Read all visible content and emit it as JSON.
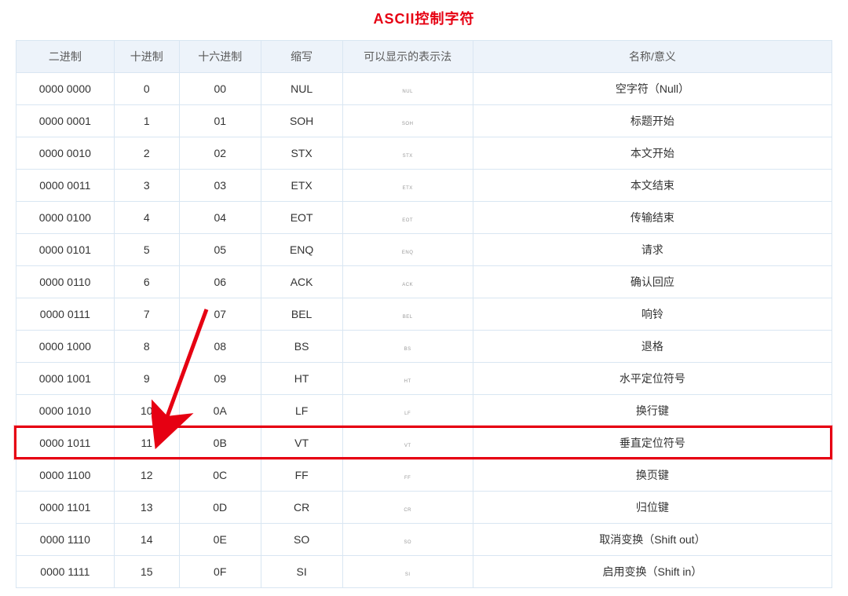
{
  "title": "ASCII控制字符",
  "columns": [
    "二进制",
    "十进制",
    "十六进制",
    "缩写",
    "可以显示的表示法",
    "名称/意义"
  ],
  "highlight_index": 11,
  "rows": [
    {
      "binary": "0000 0000",
      "decimal": "0",
      "hex": "00",
      "abbr": "NUL",
      "disp": "NUL",
      "meaning": "空字符（Null）"
    },
    {
      "binary": "0000 0001",
      "decimal": "1",
      "hex": "01",
      "abbr": "SOH",
      "disp": "SOH",
      "meaning": "标题开始"
    },
    {
      "binary": "0000 0010",
      "decimal": "2",
      "hex": "02",
      "abbr": "STX",
      "disp": "STX",
      "meaning": "本文开始"
    },
    {
      "binary": "0000 0011",
      "decimal": "3",
      "hex": "03",
      "abbr": "ETX",
      "disp": "ETX",
      "meaning": "本文结束"
    },
    {
      "binary": "0000 0100",
      "decimal": "4",
      "hex": "04",
      "abbr": "EOT",
      "disp": "EOT",
      "meaning": "传输结束"
    },
    {
      "binary": "0000 0101",
      "decimal": "5",
      "hex": "05",
      "abbr": "ENQ",
      "disp": "ENQ",
      "meaning": "请求"
    },
    {
      "binary": "0000 0110",
      "decimal": "6",
      "hex": "06",
      "abbr": "ACK",
      "disp": "ACK",
      "meaning": "确认回应"
    },
    {
      "binary": "0000 0111",
      "decimal": "7",
      "hex": "07",
      "abbr": "BEL",
      "disp": "BEL",
      "meaning": "响铃"
    },
    {
      "binary": "0000 1000",
      "decimal": "8",
      "hex": "08",
      "abbr": "BS",
      "disp": "BS",
      "meaning": "退格"
    },
    {
      "binary": "0000 1001",
      "decimal": "9",
      "hex": "09",
      "abbr": "HT",
      "disp": "HT",
      "meaning": "水平定位符号"
    },
    {
      "binary": "0000 1010",
      "decimal": "10",
      "hex": "0A",
      "abbr": "LF",
      "disp": "LF",
      "meaning": "换行键"
    },
    {
      "binary": "0000 1011",
      "decimal": "11",
      "hex": "0B",
      "abbr": "VT",
      "disp": "VT",
      "meaning": "垂直定位符号"
    },
    {
      "binary": "0000 1100",
      "decimal": "12",
      "hex": "0C",
      "abbr": "FF",
      "disp": "FF",
      "meaning": "换页键"
    },
    {
      "binary": "0000 1101",
      "decimal": "13",
      "hex": "0D",
      "abbr": "CR",
      "disp": "CR",
      "meaning": "归位键"
    },
    {
      "binary": "0000 1110",
      "decimal": "14",
      "hex": "0E",
      "abbr": "SO",
      "disp": "SO",
      "meaning": "取消变换（Shift out）"
    },
    {
      "binary": "0000 1111",
      "decimal": "15",
      "hex": "0F",
      "abbr": "SI",
      "disp": "SI",
      "meaning": "启用变换（Shift in）"
    }
  ]
}
